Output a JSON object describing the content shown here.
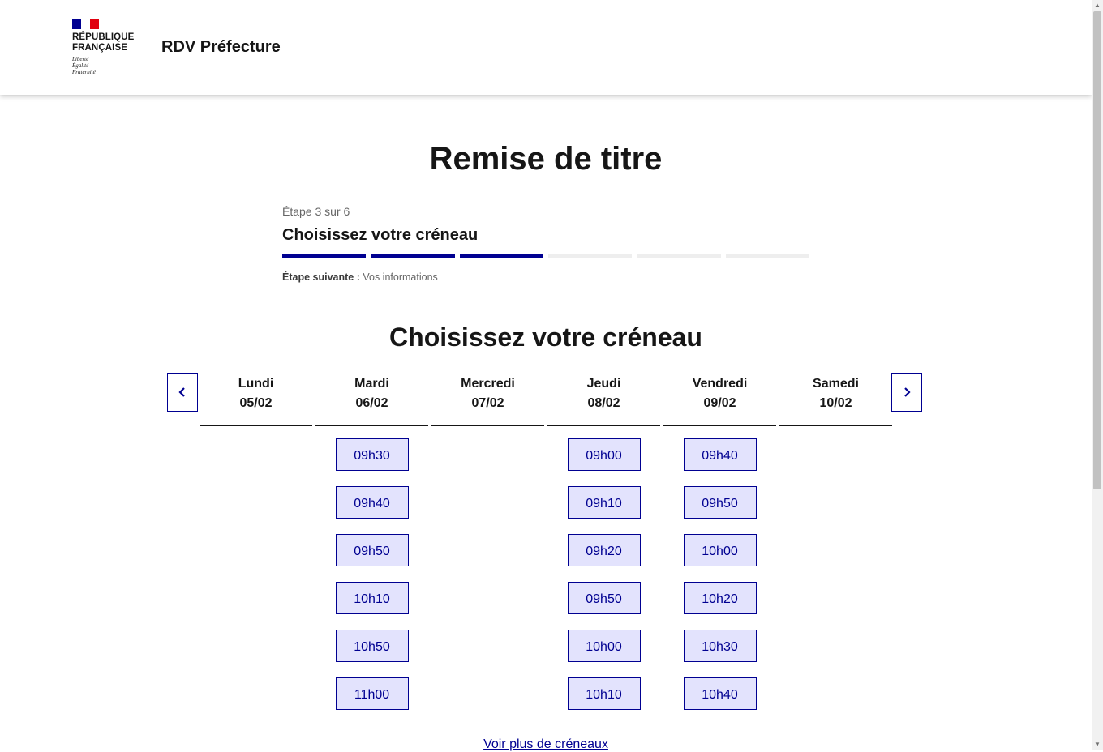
{
  "header": {
    "republic_line1": "RÉPUBLIQUE",
    "republic_line2": "FRANÇAISE",
    "motto_1": "Liberté",
    "motto_2": "Égalité",
    "motto_3": "Fraternité",
    "service_name": "RDV Préfecture",
    "flag_colors": [
      "#000091",
      "#ffffff",
      "#e1000f"
    ]
  },
  "page_title": "Remise de titre",
  "stepper": {
    "count": "Étape 3 sur 6",
    "title": "Choisissez votre créneau",
    "current": 3,
    "total": 6,
    "next_label": "Étape suivante :",
    "next_value": "Vos informations"
  },
  "calendar": {
    "title": "Choisissez votre créneau",
    "prev_icon": "chevron-left-icon",
    "next_icon": "chevron-right-icon",
    "days": [
      {
        "name": "Lundi",
        "date": "05/02",
        "slots": []
      },
      {
        "name": "Mardi",
        "date": "06/02",
        "slots": [
          "09h30",
          "09h40",
          "09h50",
          "10h10",
          "10h50",
          "11h00"
        ]
      },
      {
        "name": "Mercredi",
        "date": "07/02",
        "slots": []
      },
      {
        "name": "Jeudi",
        "date": "08/02",
        "slots": [
          "09h00",
          "09h10",
          "09h20",
          "09h50",
          "10h00",
          "10h10"
        ]
      },
      {
        "name": "Vendredi",
        "date": "09/02",
        "slots": [
          "09h40",
          "09h50",
          "10h00",
          "10h20",
          "10h30",
          "10h40"
        ]
      },
      {
        "name": "Samedi",
        "date": "10/02",
        "slots": []
      }
    ],
    "more_link": "Voir plus de créneaux"
  },
  "colors": {
    "accent": "#000091",
    "slot_bg": "#e3e3fd",
    "step_inactive": "#eeeeee"
  }
}
